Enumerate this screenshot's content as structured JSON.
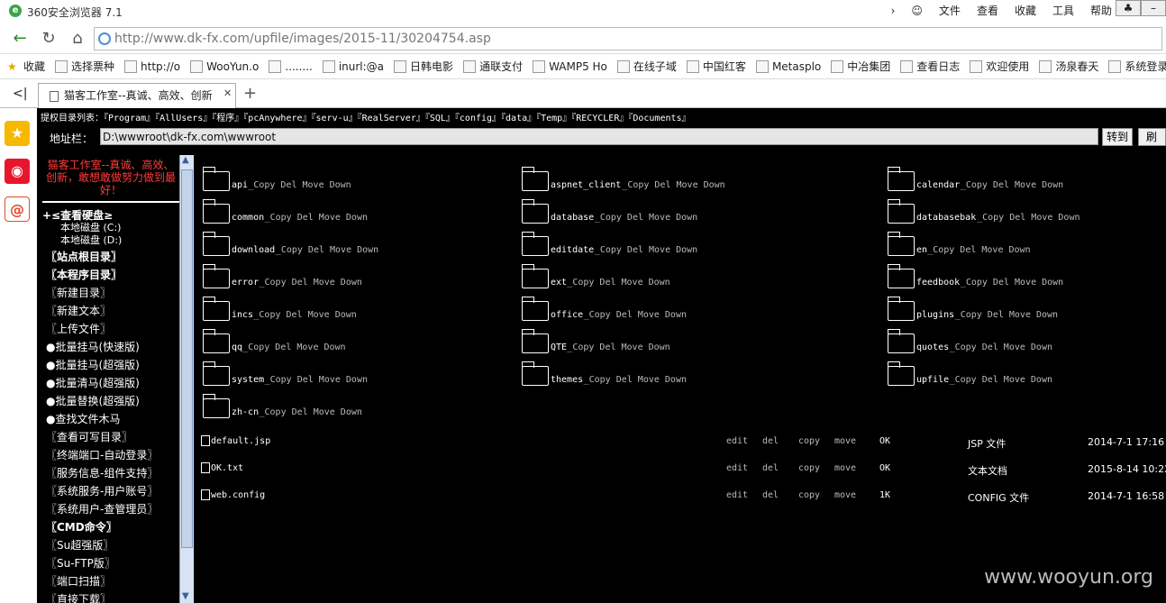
{
  "browser": {
    "title": "360安全浏览器 7.1",
    "menus": [
      "文件",
      "查看",
      "收藏",
      "工具",
      "帮助"
    ],
    "url": "http://www.dk-fx.com/upfile/images/2015-11/30204754.asp",
    "tab_title": "猫客工作室--真诚、高效、创新",
    "bookmarks": [
      "收藏",
      "选择票种",
      "http://o",
      "WooYun.o",
      "........",
      "inurl:@a",
      "日韩电影",
      "通联支付",
      "WAMP5 Ho",
      "在线子域",
      "中国红客",
      "Metasplo",
      "中冶集团",
      "查看日志",
      "欢迎使用",
      "汤泉春天",
      "系统登录"
    ]
  },
  "shell": {
    "dir_list": "提权目录列表：『Program』『AllUsers』『程序』『pcAnywhere』『serv-u』『RealServer』『SQL』『config』『data』『Temp』『RECYCLER』『Documents』",
    "addr_label": "地址栏：",
    "addr_value": "D:\\wwwroot\\dk-fx.com\\wwwroot",
    "goto_label": "转到",
    "goto2_label": "刷新",
    "slogan": "猫客工作室--真诚、高效、创新，敢想敢做努力做到最好！",
    "sidebar": [
      "+≤查看硬盘≥",
      "本地磁盘 (C:)",
      "本地磁盘 (D:)",
      "〖站点根目录〗",
      "〖本程序目录〗",
      "〖新建目录〗",
      "〖新建文本〗",
      "〖上传文件〗",
      "●批量挂马(快速版)",
      "●批量挂马(超强版)",
      "●批量清马(超强版)",
      "●批量替换(超强版)",
      "●查找文件木马",
      "〖查看可写目录〗",
      "〖终端端口-自动登录〗",
      "〖服务信息-组件支持〗",
      "〖系统服务-用户账号〗",
      "〖系统用户-查管理员〗",
      "〖CMD命令〗",
      "〖Su超强版〗",
      "〖Su-FTP版〗",
      "〖端口扫描〗",
      "〖直接下载〗"
    ],
    "folder_actions": " _Copy Del Move Down",
    "folders": [
      "api",
      "aspnet_client",
      "calendar",
      "common",
      "database",
      "databasebak",
      "download",
      "editdate",
      "en",
      "error",
      "ext",
      "feedbook",
      "incs",
      "office",
      "plugins",
      "qq",
      "QTE",
      "quotes",
      "system",
      "themes",
      "upfile",
      "zh-cn"
    ],
    "file_actions": [
      "edit",
      "del",
      "copy",
      "move"
    ],
    "files": [
      {
        "name": "default.jsp",
        "size": "OK",
        "type": "JSP 文件",
        "date": "2014-7-1 17:16"
      },
      {
        "name": "OK.txt",
        "size": "OK",
        "type": "文本文档",
        "date": "2015-8-14 10:22"
      },
      {
        "name": "web.config",
        "size": "1K",
        "type": "CONFIG 文件",
        "date": "2014-7-1 16:58"
      }
    ]
  },
  "watermark": "www.wooyun.org"
}
